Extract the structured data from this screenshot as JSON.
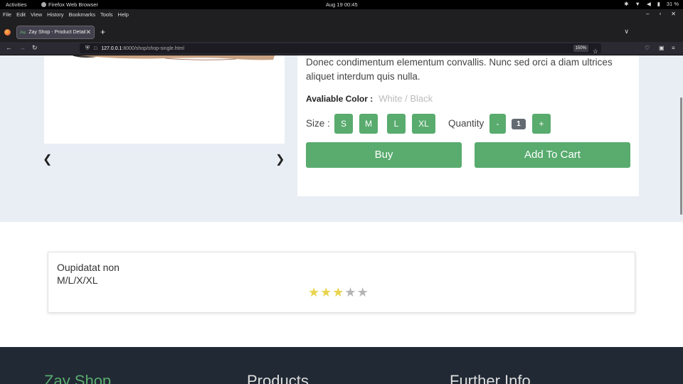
{
  "topbar": {
    "activities": "Activities",
    "app_name": "Firefox Web Browser",
    "clock": "Aug 19  00:45",
    "battery": "31 %"
  },
  "menubar": {
    "file": "File",
    "edit": "Edit",
    "view": "View",
    "history": "History",
    "bookmarks": "Bookmarks",
    "tools": "Tools",
    "help": "Help"
  },
  "tab": {
    "favicon": "Zay",
    "title": "Zay Shop - Product Detail"
  },
  "urlbar": {
    "host": "127.0.0.1",
    "path": ":8000/shop/shop-single.html",
    "zoom": "150%"
  },
  "product": {
    "description": "Donec condimentum elementum convallis. Nunc sed orci a diam ultrices aliquet interdum quis nulla.",
    "color_label": "Avaliable Color :",
    "color_value": "White / Black",
    "size_label": "Size :",
    "sizes": [
      "S",
      "M",
      "L",
      "XL"
    ],
    "quantity_label": "Quantity",
    "quantity_minus": "-",
    "quantity_value": "1",
    "quantity_plus": "+",
    "buy_label": "Buy",
    "cart_label": "Add To Cart"
  },
  "related": {
    "name": "Oupidatat non",
    "sizes": "M/L/X/XL",
    "rating": 3,
    "rating_max": 5
  },
  "footer": {
    "brand": "Zay Shop",
    "products": "Products",
    "further_info": "Further Info"
  },
  "colors": {
    "accent": "#59ab6e",
    "star_on": "#e8d44d",
    "star_off": "#b5b5b5",
    "footer_bg": "#212934"
  }
}
